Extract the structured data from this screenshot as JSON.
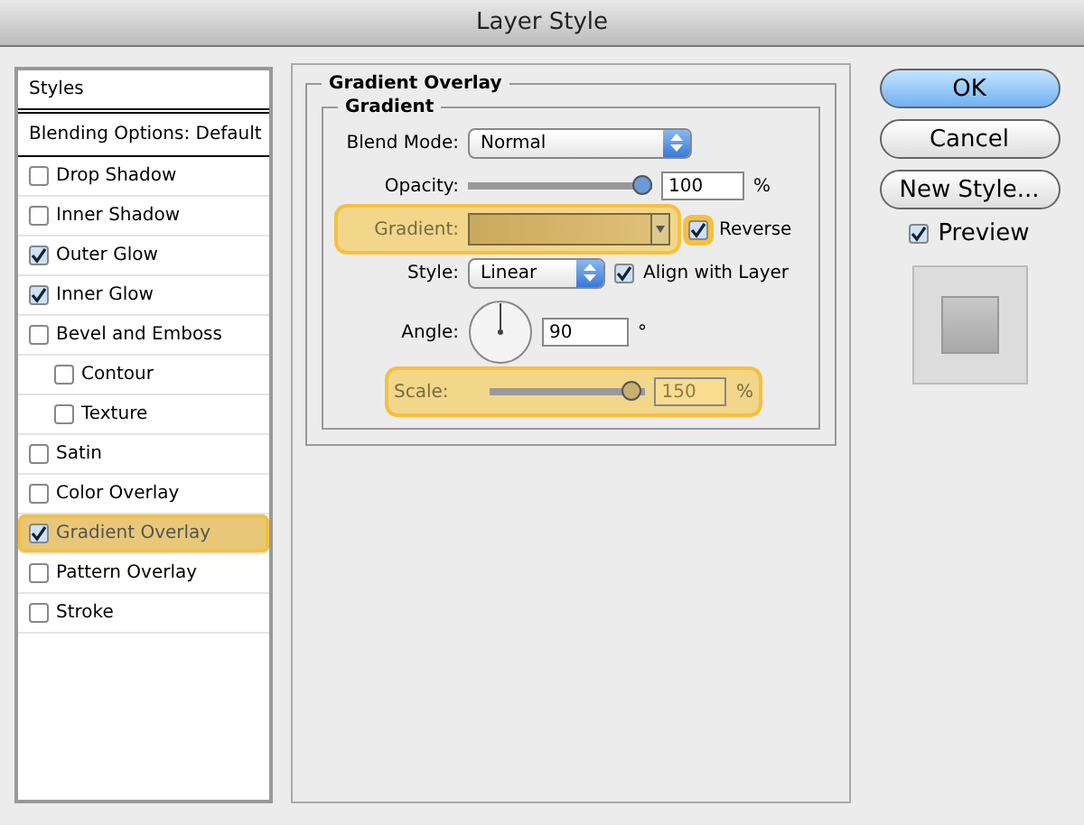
{
  "window": {
    "title": "Layer Style"
  },
  "sidebar": {
    "header": "Styles",
    "blending": "Blending Options: Default",
    "items": [
      {
        "label": "Drop Shadow",
        "checked": false,
        "selected": false
      },
      {
        "label": "Inner Shadow",
        "checked": false,
        "selected": false
      },
      {
        "label": "Outer Glow",
        "checked": true,
        "selected": false
      },
      {
        "label": "Inner Glow",
        "checked": true,
        "selected": false
      },
      {
        "label": "Bevel and Emboss",
        "checked": false,
        "selected": false,
        "children": [
          {
            "label": "Contour",
            "checked": false,
            "selected": false
          },
          {
            "label": "Texture",
            "checked": false,
            "selected": false
          }
        ]
      },
      {
        "label": "Satin",
        "checked": false,
        "selected": false
      },
      {
        "label": "Color Overlay",
        "checked": false,
        "selected": false
      },
      {
        "label": "Gradient Overlay",
        "checked": true,
        "selected": true
      },
      {
        "label": "Pattern Overlay",
        "checked": false,
        "selected": false
      },
      {
        "label": "Stroke",
        "checked": false,
        "selected": false
      }
    ]
  },
  "panel": {
    "title": "Gradient Overlay",
    "group": "Gradient",
    "blend_mode": {
      "label": "Blend Mode:",
      "value": "Normal"
    },
    "opacity": {
      "label": "Opacity:",
      "level": 1,
      "value": "100",
      "unit": "%"
    },
    "gradient": {
      "label": "Gradient:",
      "highlighted": true,
      "reverse": {
        "label": "Reverse",
        "checked": true,
        "highlighted": true
      }
    },
    "style": {
      "label": "Style:",
      "value": "Linear",
      "align": {
        "label": "Align with Layer",
        "checked": true
      }
    },
    "angle": {
      "label": "Angle:",
      "value": "90",
      "unit": "°"
    },
    "scale": {
      "label": "Scale:",
      "level": 0.97,
      "value": "150",
      "unit": "%",
      "highlighted": true
    }
  },
  "buttons": [
    {
      "label": "OK",
      "kind": "default"
    },
    {
      "label": "Cancel",
      "kind": "normal"
    },
    {
      "label": "New Style...",
      "kind": "normal"
    }
  ],
  "preview": {
    "label": "Preview",
    "checked": true
  }
}
